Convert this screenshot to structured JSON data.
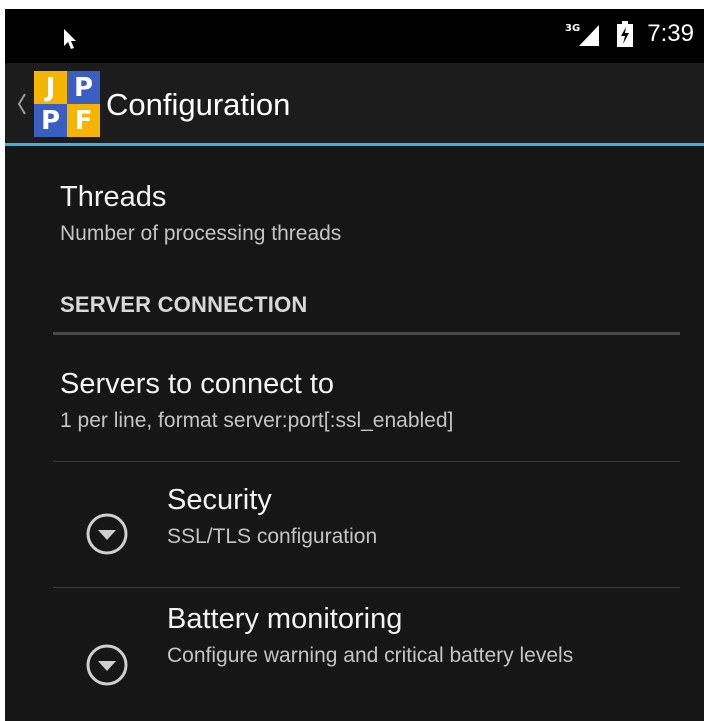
{
  "status_bar": {
    "network_type": "3G",
    "time": "7:39",
    "icons": [
      "cursor-icon",
      "signal-3g-icon",
      "battery-charging-icon"
    ]
  },
  "action_bar": {
    "title": "Configuration",
    "logo_letters": [
      "J",
      "P",
      "P",
      "F"
    ],
    "logo_colors": [
      "#f5b400",
      "#3b5fc0",
      "#3b5fc0",
      "#f5b400"
    ],
    "icons": [
      "up-chevron-icon",
      "jppf-logo"
    ]
  },
  "colors": {
    "accent": "#33b5e5",
    "background": "#161616"
  },
  "preferences": {
    "threads": {
      "title": "Threads",
      "summary": "Number of processing threads"
    },
    "server_connection_category": "SERVER CONNECTION",
    "servers": {
      "title": "Servers to connect to",
      "summary": "1 per line, format server:port[:ssl_enabled]"
    },
    "security": {
      "title": "Security",
      "summary": "SSL/TLS configuration",
      "icon": "expand-circle-icon"
    },
    "battery": {
      "title": "Battery monitoring",
      "summary": "Configure warning and critical battery levels",
      "icon": "expand-circle-icon"
    }
  }
}
